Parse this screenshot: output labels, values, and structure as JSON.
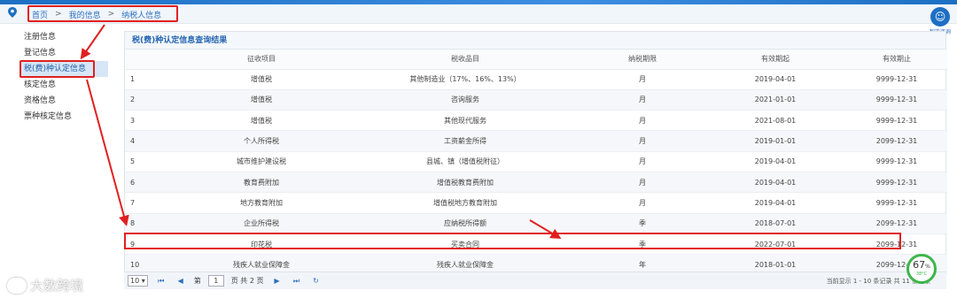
{
  "breadcrumb": [
    "首页",
    "我的信息",
    "纳税人信息"
  ],
  "breadcrumb_sep": ">",
  "help": {
    "label": "智能咨询"
  },
  "sidebar": {
    "items": [
      {
        "label": "注册信息"
      },
      {
        "label": "登记信息"
      },
      {
        "label": "税(费)种认定信息"
      },
      {
        "label": "核定信息"
      },
      {
        "label": "资格信息"
      },
      {
        "label": "票种核定信息"
      }
    ],
    "active_index": 2
  },
  "panel": {
    "title": "税(费)种认定信息查询结果"
  },
  "table": {
    "columns": [
      "",
      "征收项目",
      "税收品目",
      "纳税期限",
      "有效期起",
      "有效期止"
    ],
    "rows": [
      [
        "1",
        "增值税",
        "其他制造业（17%、16%、13%）",
        "月",
        "2019-04-01",
        "9999-12-31"
      ],
      [
        "2",
        "增值税",
        "咨询服务",
        "月",
        "2021-01-01",
        "9999-12-31"
      ],
      [
        "3",
        "增值税",
        "其他现代服务",
        "月",
        "2021-08-01",
        "9999-12-31"
      ],
      [
        "4",
        "个人所得税",
        "工资薪金所得",
        "月",
        "2019-01-01",
        "2099-12-31"
      ],
      [
        "5",
        "城市维护建设税",
        "县城、镇（增值税附征）",
        "月",
        "2019-04-01",
        "9999-12-31"
      ],
      [
        "6",
        "教育费附加",
        "增值税教育费附加",
        "月",
        "2019-04-01",
        "9999-12-31"
      ],
      [
        "7",
        "地方教育附加",
        "增值税地方教育附加",
        "月",
        "2019-04-01",
        "9999-12-31"
      ],
      [
        "8",
        "企业所得税",
        "应纳税所得额",
        "季",
        "2018-07-01",
        "2099-12-31"
      ],
      [
        "9",
        "印花税",
        "买卖合同",
        "季",
        "2022-07-01",
        "2099-12-31"
      ],
      [
        "10",
        "残疾人就业保障金",
        "残疾人就业保障金",
        "年",
        "2018-01-01",
        "2099-12-31"
      ]
    ],
    "highlighted_row_index": 8
  },
  "pager": {
    "page_size": "10",
    "page_prefix": "第",
    "page_value": "1",
    "page_suffix": "页 共 2 页",
    "info": "当前显示 1 - 10 条记录 共 11 条记录"
  },
  "watermark": "大数跨境",
  "gauge": {
    "percent": 67,
    "percent_sign": "%",
    "temperature": "38°C"
  },
  "colors": {
    "accent": "#1d6fc4",
    "annotation": "#e02020",
    "gauge": "#3cb64a"
  }
}
